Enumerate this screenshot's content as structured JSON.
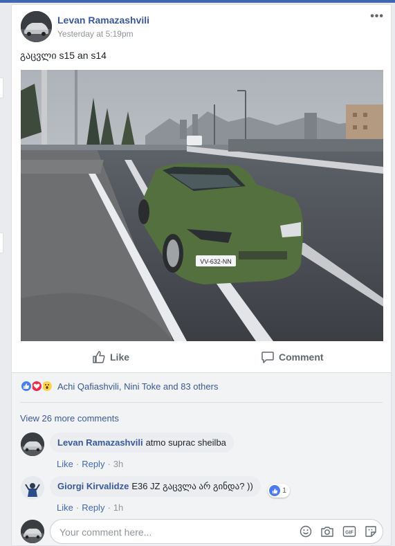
{
  "post": {
    "author": "Levan Ramazashvili",
    "timestamp": "Yesterday at 5:19pm",
    "text": "გაცვლი s15 an s14",
    "more_label": "•••",
    "photo_plate": "VV-632-NN"
  },
  "actions": {
    "like_label": "Like",
    "comment_label": "Comment"
  },
  "reactions": {
    "types": [
      "like",
      "love",
      "wow"
    ],
    "summary": "Achi Qafiashvili, Nini Toke and 83 others"
  },
  "comments": {
    "view_more_label": "View 26 more comments",
    "like_action": "Like",
    "reply_action": "Reply",
    "separator": "·",
    "items": [
      {
        "author": "Levan Ramazashvili",
        "text": "atmo suprac sheilba",
        "time": "3h",
        "likes": null
      },
      {
        "author": "Giorgi Kirvalidze",
        "text": "E36 JZ გაცვლა არ გინდა? ))",
        "time": "1h",
        "likes": "1"
      }
    ]
  },
  "composer": {
    "placeholder": "Your comment here...",
    "icons": [
      "emoji-icon",
      "camera-icon",
      "gif-icon",
      "sticker-icon"
    ]
  },
  "colors": {
    "link": "#385898",
    "brand": "#4267b2",
    "meta": "#90949c",
    "car_green": "#55703f"
  }
}
